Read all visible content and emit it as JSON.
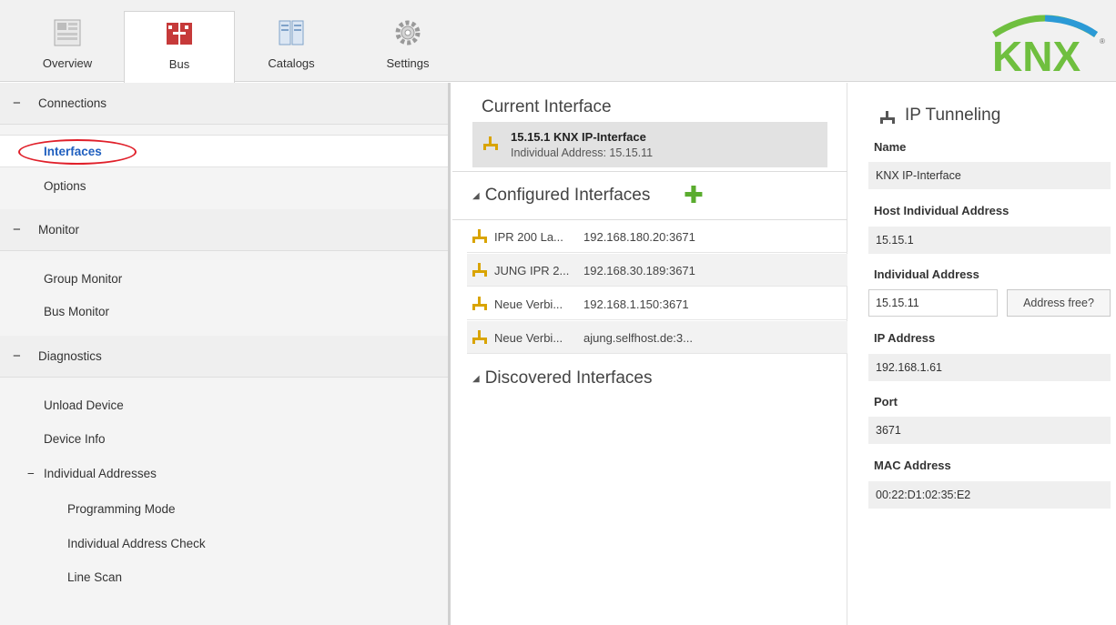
{
  "tabs": [
    {
      "label": "Overview",
      "icon": "overview-icon"
    },
    {
      "label": "Bus",
      "icon": "bus-icon"
    },
    {
      "label": "Catalogs",
      "icon": "catalogs-icon"
    },
    {
      "label": "Settings",
      "icon": "settings-icon"
    }
  ],
  "active_tab": "Bus",
  "logo": {
    "text": "KNX",
    "registered": "®"
  },
  "nav": {
    "connections": {
      "toggle": "−",
      "label": "Connections"
    },
    "interfaces": {
      "label": "Interfaces"
    },
    "options": {
      "label": "Options"
    },
    "monitor": {
      "toggle": "−",
      "label": "Monitor"
    },
    "group_monitor": {
      "label": "Group Monitor"
    },
    "bus_monitor": {
      "label": "Bus Monitor"
    },
    "diagnostics": {
      "toggle": "−",
      "label": "Diagnostics"
    },
    "unload_device": {
      "label": "Unload Device"
    },
    "device_info": {
      "label": "Device Info"
    },
    "individual_addresses": {
      "toggle": "−",
      "label": "Individual Addresses"
    },
    "programming_mode": {
      "label": "Programming Mode"
    },
    "individual_address_check": {
      "label": "Individual Address Check"
    },
    "line_scan": {
      "label": "Line Scan"
    }
  },
  "current": {
    "title": "Current Interface",
    "name": "15.15.1 KNX IP-Interface",
    "address": "Individual Address: 15.15.11"
  },
  "configured": {
    "expander": "◢",
    "title": "Configured Interfaces",
    "add": "✚",
    "rows": [
      {
        "name": "IPR 200 La...",
        "address": "192.168.180.20:3671"
      },
      {
        "name": "JUNG IPR 2...",
        "address": "192.168.30.189:3671"
      },
      {
        "name": "Neue Verbi...",
        "address": "192.168.1.150:3671"
      },
      {
        "name": "Neue Verbi...",
        "address": "ajung.selfhost.de:3..."
      }
    ]
  },
  "discovered": {
    "expander": "◢",
    "title": "Discovered Interfaces"
  },
  "details": {
    "title": "IP Tunneling",
    "name_label": "Name",
    "name_value": "KNX IP-Interface",
    "host_label": "Host Individual Address",
    "host_value": "15.15.1",
    "ind_label": "Individual Address",
    "ind_value": "15.15.11",
    "address_free_button": "Address free?",
    "ip_label": "IP Address",
    "ip_value": "192.168.1.61",
    "port_label": "Port",
    "port_value": "3671",
    "mac_label": "MAC Address",
    "mac_value": "00:22:D1:02:35:E2"
  },
  "colors": {
    "accent_blue": "#1f5fbf",
    "annotation_red": "#e0202a",
    "add_green": "#5aac2e",
    "knx_green": "#6fbf3f",
    "knx_blue": "#2b9ad6"
  }
}
